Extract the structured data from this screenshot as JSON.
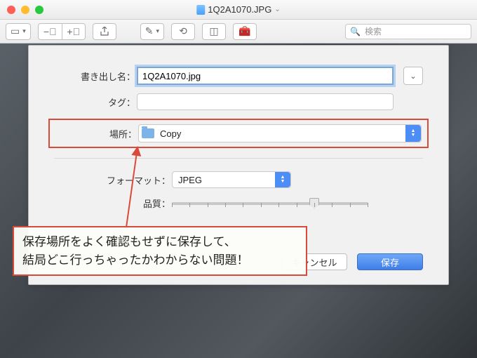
{
  "titlebar": {
    "filename": "1Q2A1070.JPG"
  },
  "search": {
    "placeholder": "検索"
  },
  "export": {
    "name_label": "書き出し名：",
    "name_value": "1Q2A1070.jpg",
    "tag_label": "タグ：",
    "location_label": "場所：",
    "location_value": "Copy",
    "format_label": "フォーマット：",
    "format_value": "JPEG",
    "quality_label": "品質：",
    "quality_ticks": 12,
    "quality_position_pct": 70
  },
  "buttons": {
    "cancel": "キャンセル",
    "save": "保存"
  },
  "annotation": {
    "line1": "保存場所をよく確認もせずに保存して、",
    "line2": "結局どこ行っちゃったかわからない問題！"
  },
  "colors": {
    "highlight": "#d94a3a",
    "accent": "#4c8ef5"
  }
}
